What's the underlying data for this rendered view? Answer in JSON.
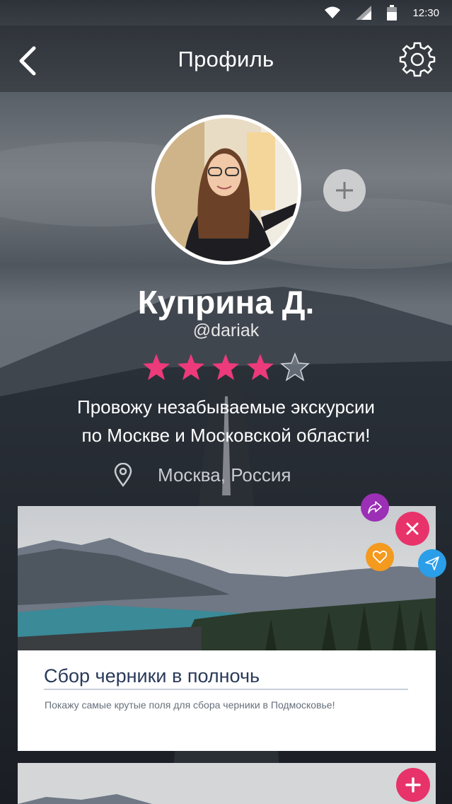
{
  "status_bar": {
    "time": "12:30",
    "icons": [
      "wifi-icon",
      "signal-icon",
      "battery-icon"
    ]
  },
  "nav": {
    "title": "Профиль",
    "back_icon": "chevron-left-icon",
    "settings_icon": "gear-icon"
  },
  "profile": {
    "name": "Куприна Д.",
    "handle": "@dariak",
    "rating": 4,
    "rating_max": 5,
    "bio": "Провожу незабываемые экскурсии по Москве и Московской области!",
    "bio_line1": "Провожу незабываемые экскурсии",
    "bio_line2": "по Москве и Московской области!",
    "location": "Москва, Россия",
    "add_photo_icon": "plus-icon"
  },
  "tours": [
    {
      "title": "Сбор черники в полночь",
      "description": "Покажу самые крутые поля для сбора черники в Подмосковье!",
      "actions": [
        "share-icon",
        "close-icon",
        "heart-icon",
        "send-icon"
      ]
    },
    {
      "title": "",
      "description": "",
      "actions": [
        "plus-icon"
      ]
    }
  ],
  "colors": {
    "star_active": "#ec3a7b",
    "star_inactive": "#8a929c",
    "share": "#9b2fb5",
    "close": "#e8336a",
    "like": "#f39a1f",
    "send": "#2a9ee8",
    "title_text": "#2a3a5a"
  }
}
